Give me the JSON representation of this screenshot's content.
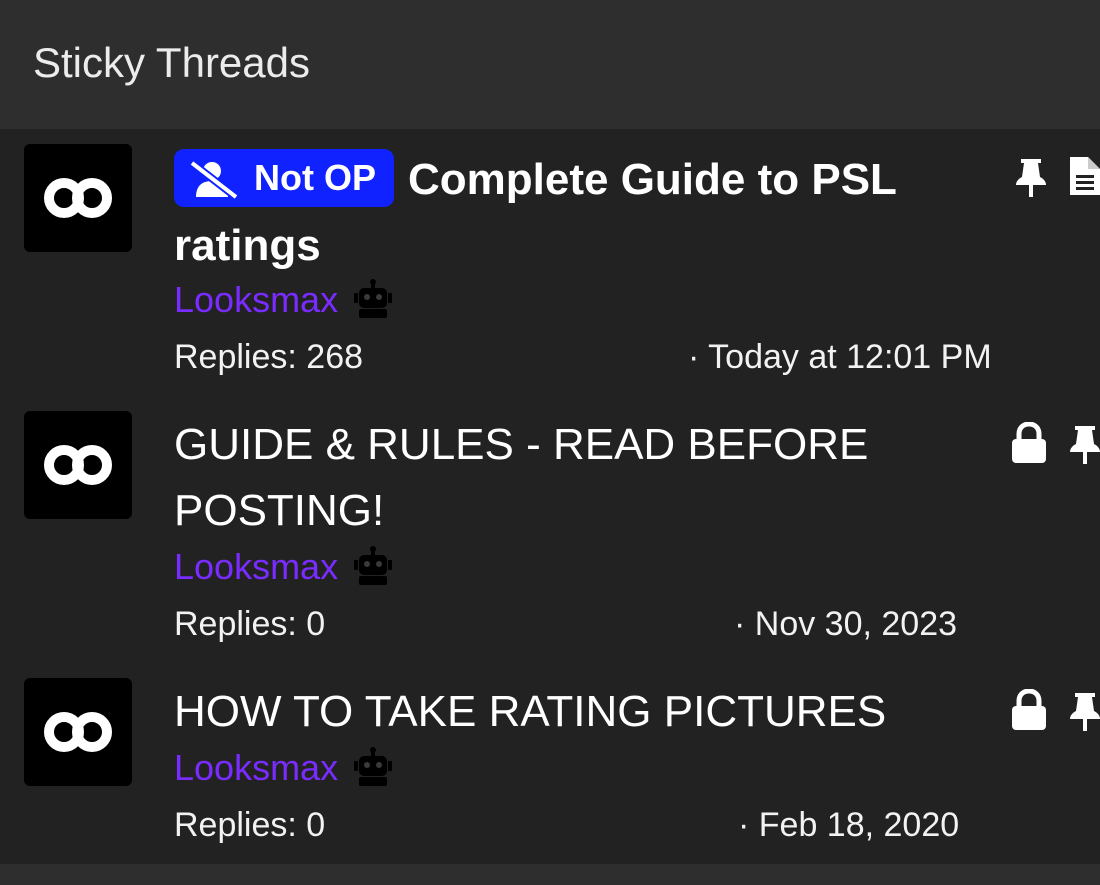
{
  "header": {
    "title": "Sticky Threads"
  },
  "threads": [
    {
      "prefix": "Not OP",
      "title_line1": "Complete Guide to PSL",
      "title_line2": "ratings",
      "author": "Looksmax",
      "replies": "Replies: 268",
      "date": "· Today at 12:01 PM",
      "status_icons": [
        "pin-icon",
        "document-icon"
      ]
    },
    {
      "title_line1": "GUIDE & RULES - READ BEFORE",
      "title_line2": "POSTING!",
      "author": "Looksmax",
      "replies": "Replies: 0",
      "date": "· Nov 30, 2023",
      "status_icons": [
        "lock-icon",
        "pin-icon"
      ]
    },
    {
      "title_line1": "HOW TO TAKE RATING PICTURES",
      "author": "Looksmax",
      "replies": "Replies: 0",
      "date": "· Feb 18, 2020",
      "status_icons": [
        "lock-icon",
        "pin-icon"
      ]
    }
  ],
  "colors": {
    "badge": "#0f22ff",
    "author": "#7a2bff",
    "list_bg": "#222222",
    "header_bg": "#2e2e2e"
  }
}
